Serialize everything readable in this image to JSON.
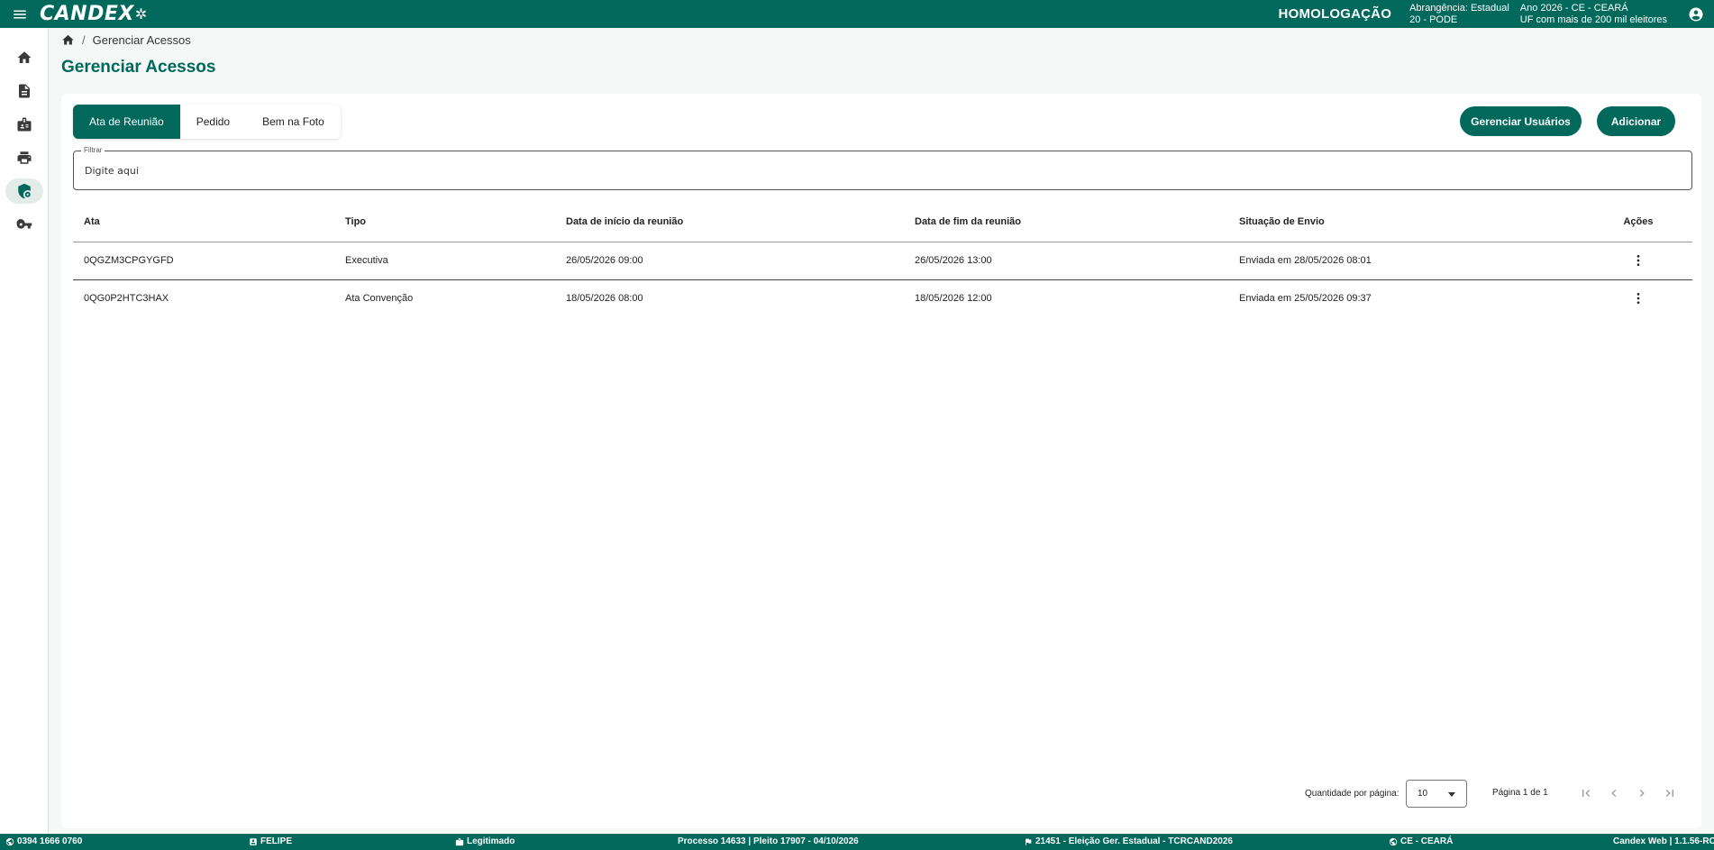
{
  "header": {
    "logo_text": "CANDEX",
    "environment": "HOMOLOGAÇÃO",
    "scope_line1": "Abrangência: Estadual",
    "scope_line2": "20 - PODE",
    "year_line1": "Ano 2026 - CE - CEARÁ",
    "year_line2": "UF com mais de 200 mil eleitores"
  },
  "breadcrumb": {
    "current": "Gerenciar Acessos"
  },
  "page": {
    "title": "Gerenciar Acessos"
  },
  "tabs": [
    {
      "label": "Ata de Reunião"
    },
    {
      "label": "Pedido"
    },
    {
      "label": "Bem na Foto"
    }
  ],
  "actions": {
    "manage_users": "Gerenciar Usuários",
    "add": "Adicionar"
  },
  "filter": {
    "label": "Filtrar",
    "placeholder": "Digite aqui",
    "value": ""
  },
  "table": {
    "columns": [
      "Ata",
      "Tipo",
      "Data de início da reunião",
      "Data de fim da reunião",
      "Situação de Envio",
      "Ações"
    ],
    "rows": [
      {
        "ata": "0QGZM3CPGYGFD",
        "tipo": "Executiva",
        "inicio": "26/05/2026 09:00",
        "fim": "26/05/2026 13:00",
        "situacao": "Enviada em 28/05/2026 08:01"
      },
      {
        "ata": "0QG0P2HTC3HAX",
        "tipo": "Ata Convenção",
        "inicio": "18/05/2026 08:00",
        "fim": "18/05/2026 12:00",
        "situacao": "Enviada em 25/05/2026 09:37"
      }
    ]
  },
  "pagination": {
    "per_page_label": "Quantidade por página:",
    "per_page_value": "10",
    "page_info": "Página 1 de 1"
  },
  "footer": {
    "phone": "0394 1666 0760",
    "user": "FELIPE",
    "status": "Legitimado",
    "process": "Processo 14633 | Pleito 17907 - 04/10/2026",
    "election": "21451 - Eleição Ger. Estadual - TCRCAND2026",
    "uf": "CE - CEARÁ",
    "version": "Candex Web | 1.1.56-RC"
  },
  "colors": {
    "primary": "#00695c",
    "background": "#f4f8f7"
  },
  "icons": [
    "menu-icon",
    "account-circle-icon",
    "home-icon",
    "document-icon",
    "id-badge-icon",
    "printer-icon",
    "shield-gear-icon",
    "key-icon",
    "more-vert-icon",
    "first-page-icon",
    "chevron-left-icon",
    "chevron-right-icon",
    "last-page-icon"
  ]
}
